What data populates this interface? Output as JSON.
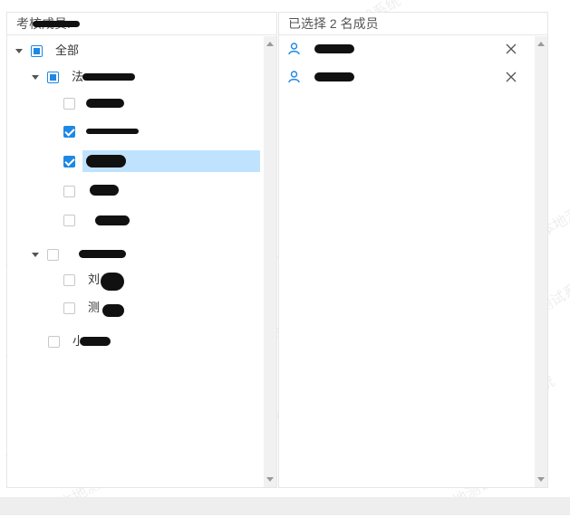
{
  "left_panel": {
    "header": "考核成员:",
    "tree": [
      {
        "label": "全部",
        "level": 0,
        "state": "partial",
        "expanded": true
      },
      {
        "label": "法",
        "level": 1,
        "state": "partial",
        "expanded": true
      },
      {
        "label": "",
        "level": 2,
        "state": "unchecked"
      },
      {
        "label": "",
        "level": 2,
        "state": "checked"
      },
      {
        "label": "",
        "level": 2,
        "state": "checked",
        "selected": true
      },
      {
        "label": "",
        "level": 2,
        "state": "unchecked"
      },
      {
        "label": "",
        "level": 2,
        "state": "unchecked"
      },
      {
        "label": "",
        "level": 1,
        "state": "unchecked",
        "expanded": true
      },
      {
        "label": "刘",
        "level": 2,
        "state": "unchecked"
      },
      {
        "label": "测",
        "level": 2,
        "state": "unchecked"
      },
      {
        "label": "小",
        "level": 1,
        "state": "unchecked"
      }
    ]
  },
  "right_panel": {
    "header": "已选择 2 名成员",
    "members": [
      {
        "name": "",
        "icon": "user-icon",
        "remove_label": "X"
      },
      {
        "name": "",
        "icon": "user-icon",
        "remove_label": "X"
      }
    ]
  },
  "watermark_text": "本地测试系统",
  "colors": {
    "accent": "#1e88e5",
    "selected_row": "#bfe3ff",
    "icon_blue": "#1e88e5"
  }
}
